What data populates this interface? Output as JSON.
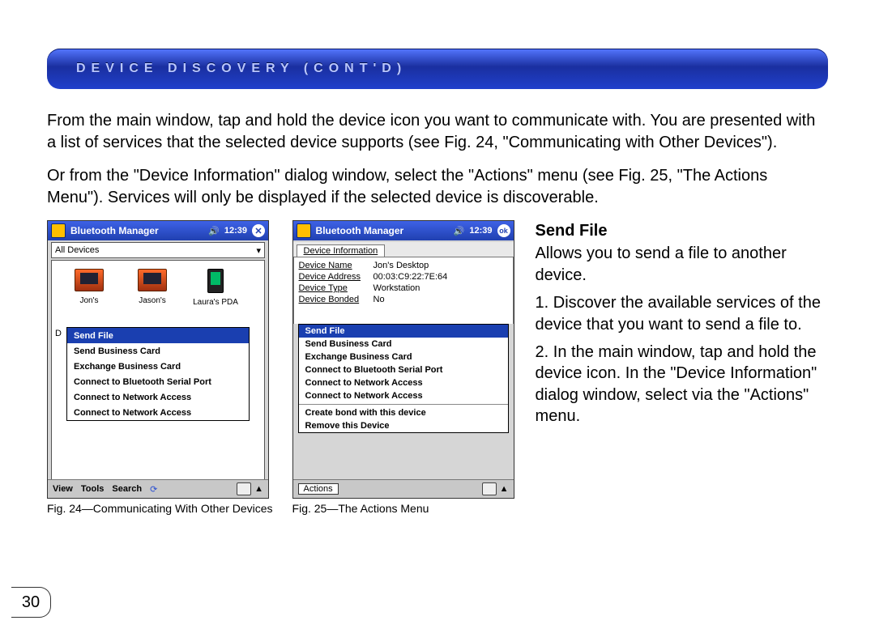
{
  "banner": {
    "title": "DEVICE DISCOVERY (CONT'D)"
  },
  "para1": "From the main window, tap and hold the device icon you want to communicate with. You are presented with a list of services that the selected device supports (see Fig. 24, \"Communicating with Other Devices\").",
  "para2": "Or from the \"Device Information\" dialog window, select the \"Actions\" menu (see Fig. 25, \"The Actions Menu\"). Services will only be displayed if the selected device is discoverable.",
  "fig24": {
    "caption": "Fig. 24—Communicating With Other Devices",
    "title": "Bluetooth Manager",
    "time": "12:39",
    "closeGlyph": "✕",
    "combo": "All Devices",
    "devices": [
      {
        "label": "Jon's"
      },
      {
        "label": "Jason's"
      },
      {
        "label": "Laura's PDA"
      }
    ],
    "deskPrefix": "D",
    "menu": [
      "Send File",
      "Send Business Card",
      "Exchange Business Card",
      "Connect to Bluetooth Serial Port",
      "Connect to Network Access",
      "Connect to Network Access"
    ],
    "softbar": {
      "view": "View",
      "tools": "Tools",
      "search": "Search",
      "up": "▲"
    }
  },
  "fig25": {
    "caption": "Fig. 25—The Actions Menu",
    "title": "Bluetooth Manager",
    "time": "12:39",
    "okGlyph": "ok",
    "tab": "Device Information",
    "info": {
      "name_k": "Device Name",
      "name_v": "Jon's Desktop",
      "addr_k": "Device Address",
      "addr_v": "00:03:C9:22:7E:64",
      "type_k": "Device Type",
      "type_v": "Workstation",
      "bond_k": "Device Bonded",
      "bond_v": "No"
    },
    "menu1": [
      "Send File",
      "Send Business Card",
      "Exchange Business Card",
      "Connect to Bluetooth Serial Port",
      "Connect to Network Access",
      "Connect to Network Access"
    ],
    "menu2": [
      "Create bond with this device",
      "Remove this Device"
    ],
    "softbar": {
      "actions": "Actions",
      "up": "▲"
    }
  },
  "right": {
    "heading": "Send File",
    "intro": "Allows you to send a file to another device.",
    "step1_num": "1.",
    "step1": " Discover the available services of the device that you want to send a file to.",
    "step2_num": "2.",
    "step2": " In the main window, tap and hold the device icon. In the \"Device Information\" dialog window, select via the \"Actions\" menu."
  },
  "pageNumber": "30"
}
